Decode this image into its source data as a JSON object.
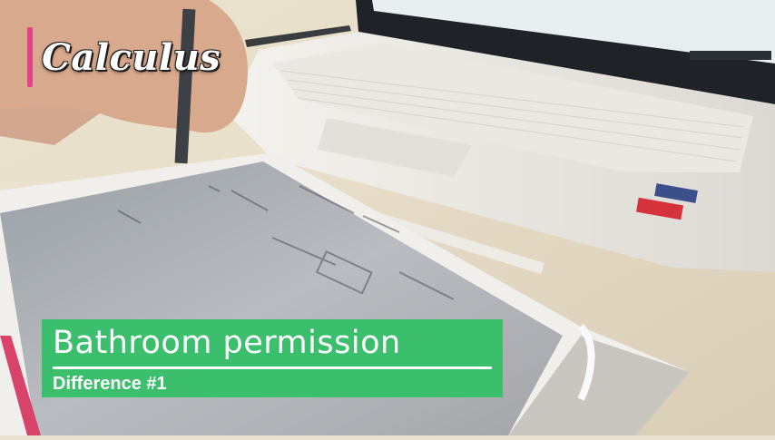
{
  "brand": {
    "title": "Calculus",
    "accent_color": "#e0438a"
  },
  "caption": {
    "title": "Bathroom permission",
    "subtitle": "Difference #1",
    "background_color": "#3cbf6c"
  },
  "scene": {
    "description_icons": [
      "laptop-icon",
      "tablet-icon",
      "stylus-icon",
      "hand-icon"
    ]
  }
}
